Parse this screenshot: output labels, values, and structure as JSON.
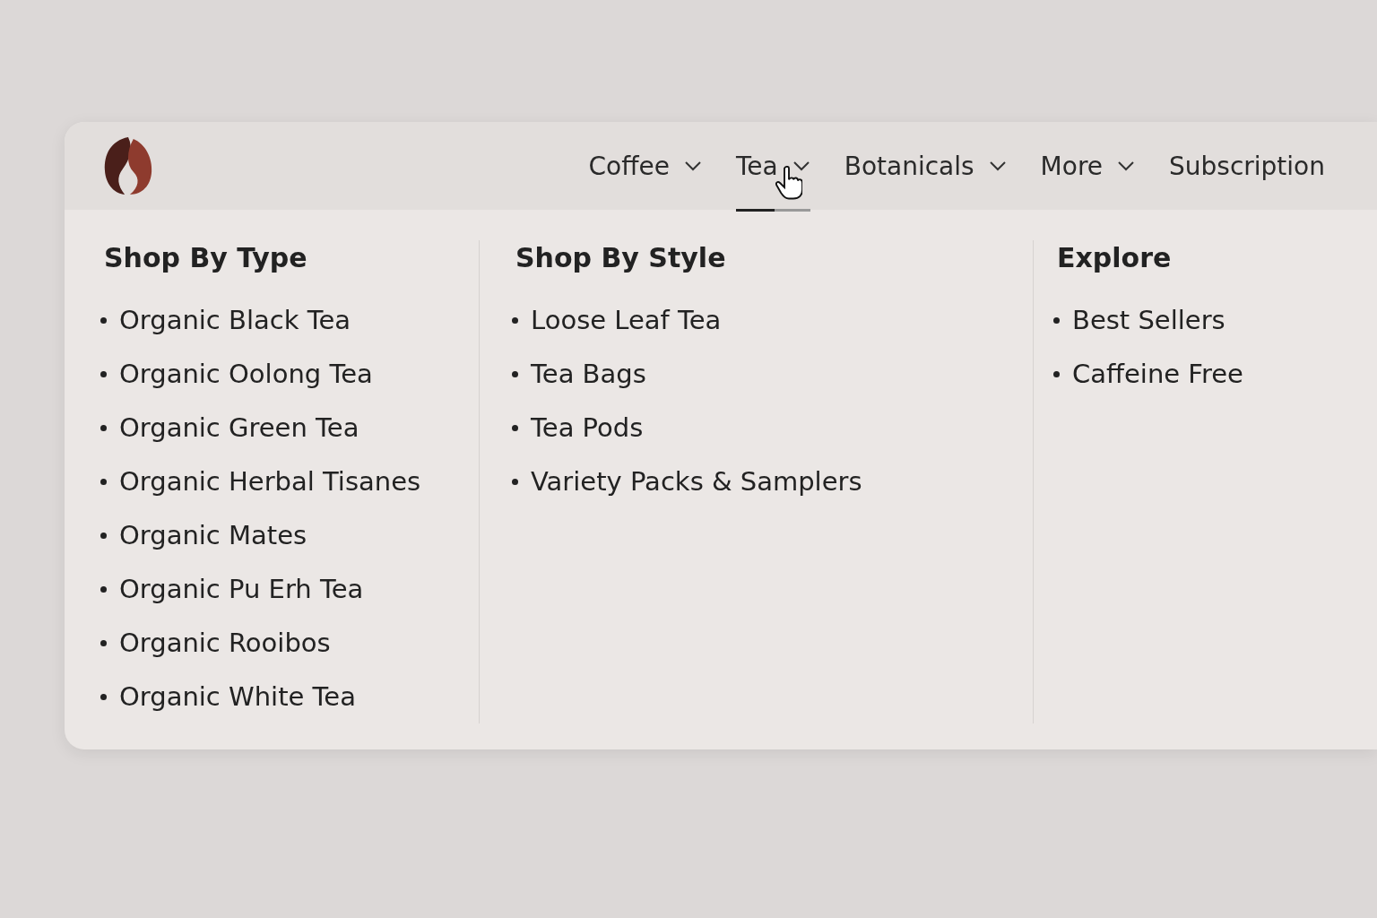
{
  "nav": [
    {
      "label": "Coffee",
      "has_dropdown": true,
      "selected": false
    },
    {
      "label": "Tea",
      "has_dropdown": true,
      "selected": true
    },
    {
      "label": "Botanicals",
      "has_dropdown": true,
      "selected": false
    },
    {
      "label": "More",
      "has_dropdown": true,
      "selected": false
    },
    {
      "label": "Subscription",
      "has_dropdown": false,
      "selected": false
    }
  ],
  "menu_columns": [
    {
      "heading": "Shop By Type",
      "items": [
        "Organic Black Tea",
        "Organic Oolong Tea",
        "Organic Green Tea",
        "Organic Herbal Tisanes",
        "Organic Mates",
        "Organic Pu Erh Tea",
        "Organic Rooibos",
        "Organic White Tea"
      ]
    },
    {
      "heading": "Shop By Style",
      "items": [
        "Loose Leaf Tea",
        "Tea Bags",
        "Tea Pods",
        "Variety Packs & Samplers"
      ]
    },
    {
      "heading": "Explore",
      "items": [
        "Best Sellers",
        "Caffeine Free"
      ]
    }
  ]
}
